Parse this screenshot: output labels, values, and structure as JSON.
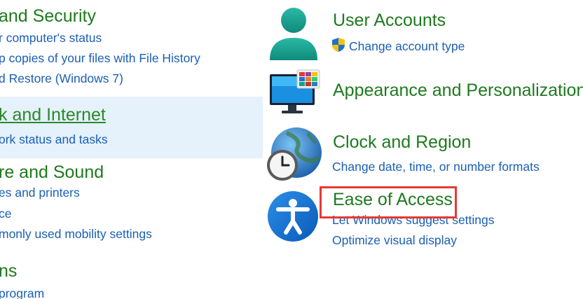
{
  "left": {
    "system_security": {
      "title": "and Security",
      "links": [
        "r computer's status",
        "p copies of your files with File History",
        "d Restore (Windows 7)"
      ]
    },
    "network": {
      "title": "k and Internet",
      "links": [
        "ork status and tasks"
      ]
    },
    "hardware": {
      "title": "re and Sound",
      "links": [
        "es and printers",
        "ce",
        "monly used mobility settings"
      ]
    },
    "programs": {
      "title": "ns",
      "links": [
        "program"
      ]
    }
  },
  "right": {
    "user_accounts": {
      "title": "User Accounts",
      "link": "Change account type"
    },
    "appearance": {
      "title": "Appearance and Personalization"
    },
    "clock": {
      "title": "Clock and Region",
      "link": "Change date, time, or number formats"
    },
    "ease": {
      "title": "Ease of Access",
      "links": [
        "Let Windows suggest settings",
        "Optimize visual display"
      ]
    }
  },
  "colors": {
    "category_green": "#1e7a1e",
    "link_blue": "#1a5fb4",
    "highlight": "#e5f1fb",
    "annotation_red": "#e53935"
  },
  "icons": [
    "user-accounts-icon",
    "monitor-personalization-icon",
    "clock-globe-icon",
    "accessibility-icon",
    "uac-shield-icon"
  ]
}
